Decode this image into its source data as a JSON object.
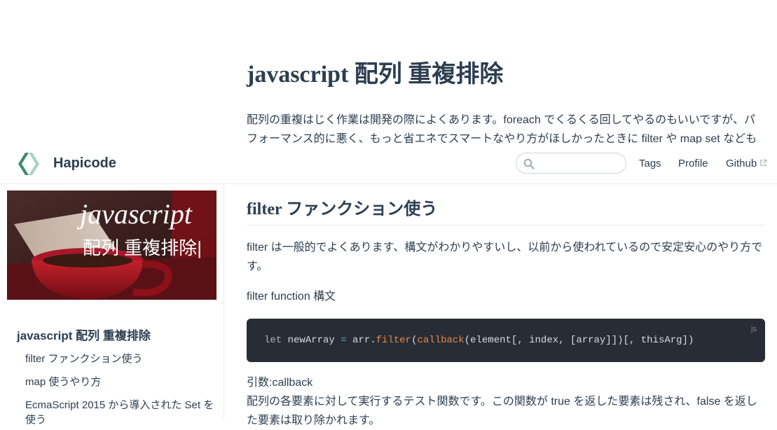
{
  "header": {
    "site_name": "Hapicode",
    "search_placeholder": "",
    "nav": [
      {
        "label": "Tags"
      },
      {
        "label": "Profile"
      },
      {
        "label": "Github"
      }
    ]
  },
  "article": {
    "title": "javascript 配列 重複排除",
    "intro_line1": "配列の重複はじく作業は開発の際によくあります。foreach でくるくる回してやるのもいいですが、パ",
    "intro_line2": "フォーマンス的に悪く、もっと省エネでスマートなやり方がほしかったときに filter や map set なども",
    "section_title": "filter ファンクション使う",
    "p1": "filter は一般的でよくあります、構文がわかりやすいし、以前から使われているので安定安心のやり方です。",
    "p2": "filter function 構文",
    "code": {
      "lang": "js",
      "tok_let": "let",
      "tok_var": " newArray ",
      "tok_eq": "=",
      "tok_arr": " arr.",
      "tok_filter": "filter",
      "tok_paren": "(",
      "tok_callback": "callback",
      "tok_rest": "(element[, index, [array]])[, thisArg])"
    },
    "p3_label": "引数:callback",
    "p3_text": "配列の各要素に対して実行するテスト関数です。この関数が true を返した要素は残され、false を返した要素は取り除かれます。"
  },
  "sidebar": {
    "thumbnail": {
      "line1": "javascript",
      "line2": "配列 重複排除|"
    },
    "title": "javascript 配列 重複排除",
    "items": [
      {
        "label": "filter ファンクション使う"
      },
      {
        "label": "map 使うやり方"
      },
      {
        "label": "EcmaScript 2015 から導入された Set を使う"
      }
    ]
  },
  "colors": {
    "text": "#2c3e50",
    "code_bg": "#282c34",
    "logo_dark": "#3f8a78",
    "logo_light": "#a7d3c3"
  }
}
